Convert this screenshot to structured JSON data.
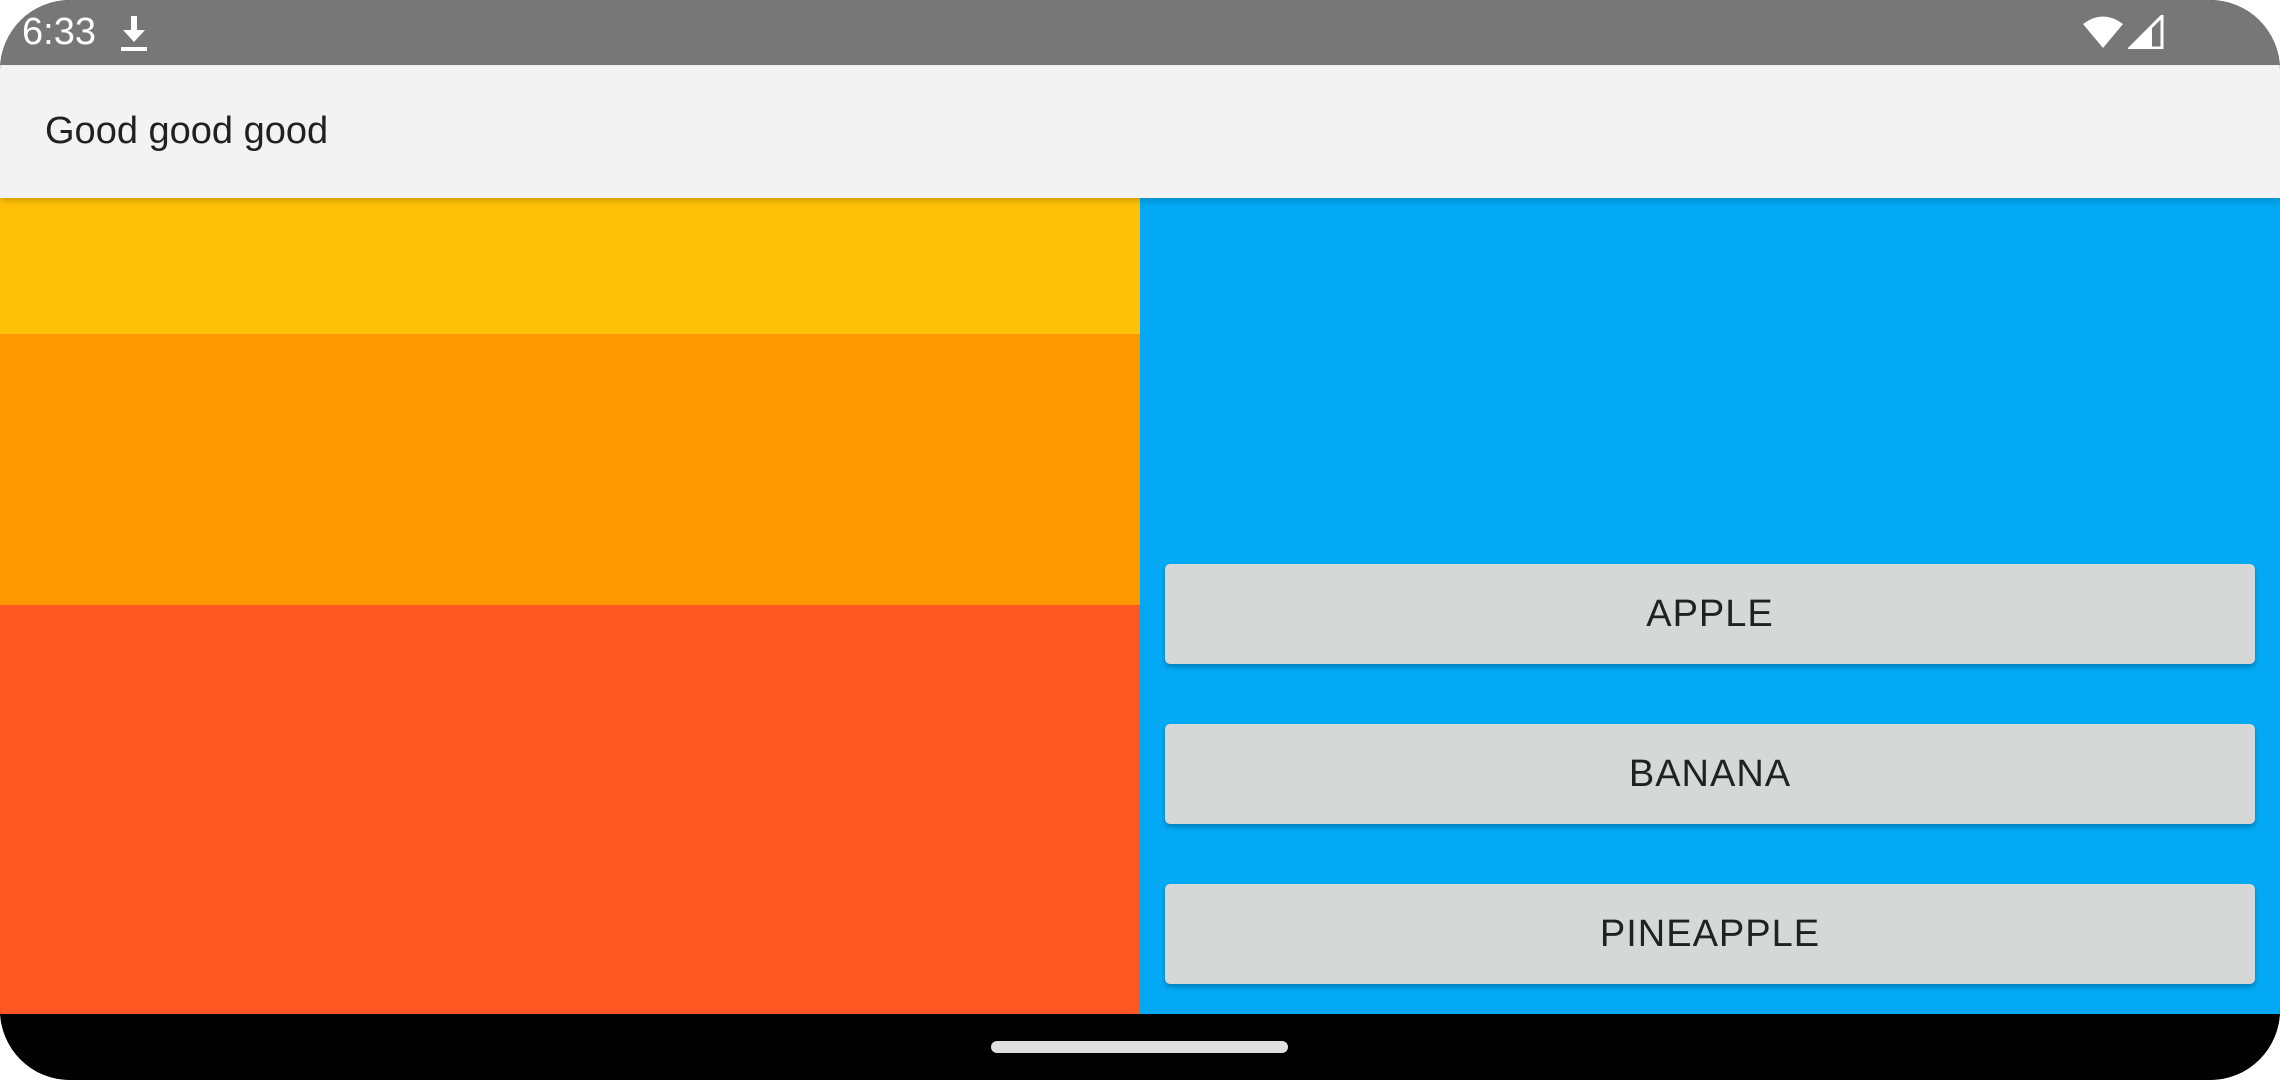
{
  "status_bar": {
    "time": "6:33",
    "icons": [
      "download-icon",
      "wifi-icon",
      "signal-icon"
    ]
  },
  "app_bar": {
    "title": "Good good good"
  },
  "left_pane": {
    "blocks": [
      {
        "name": "amber",
        "color": "#FFC107"
      },
      {
        "name": "orange",
        "color": "#FF9800"
      },
      {
        "name": "deep-orange",
        "color": "#FF5722"
      }
    ]
  },
  "right_pane": {
    "background": "#03A9F4",
    "buttons": [
      {
        "label": "APPLE"
      },
      {
        "label": "BANANA"
      },
      {
        "label": "PINEAPPLE"
      }
    ]
  },
  "nav_bar": {
    "icons": [
      "home-handle"
    ]
  }
}
